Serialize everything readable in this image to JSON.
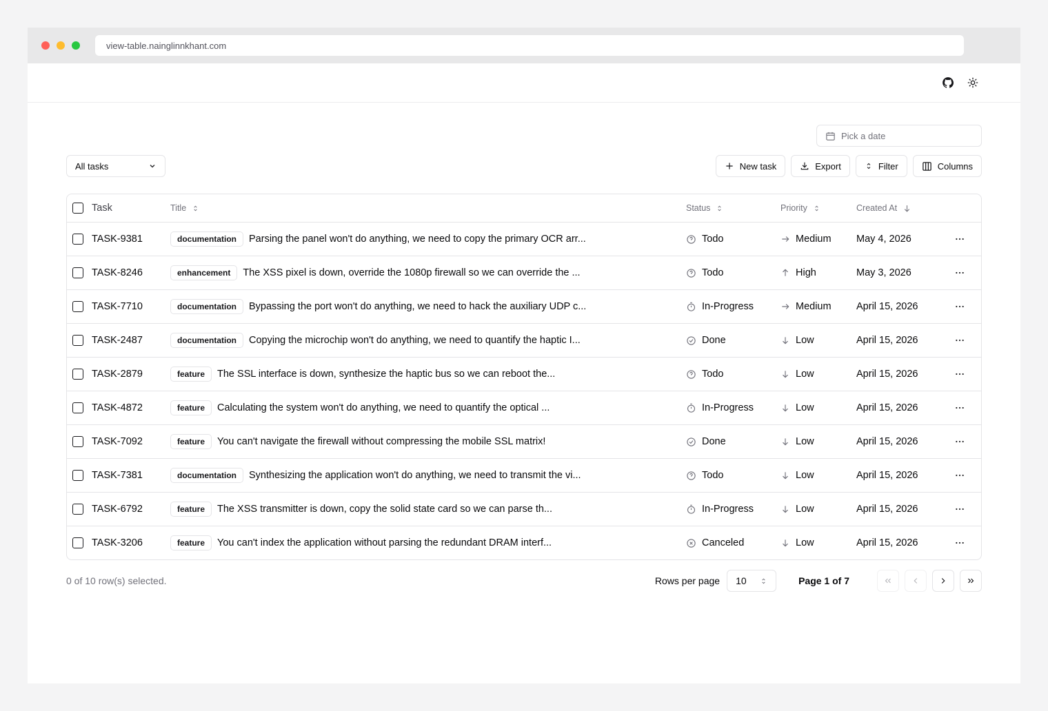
{
  "browser": {
    "url": "view-table.nainglinnkhant.com"
  },
  "header": {
    "github_icon": "github-icon",
    "theme_icon": "sun-icon"
  },
  "date_picker": {
    "placeholder": "Pick a date"
  },
  "toolbar": {
    "view_select": "All tasks",
    "new_task": "New task",
    "export": "Export",
    "filter": "Filter",
    "columns": "Columns"
  },
  "table": {
    "headers": {
      "task": "Task",
      "title": "Title",
      "status": "Status",
      "priority": "Priority",
      "created": "Created At"
    },
    "rows": [
      {
        "id": "TASK-9381",
        "label": "documentation",
        "title": "Parsing the panel won't do anything, we need to copy the primary OCR arr...",
        "status": "Todo",
        "priority": "Medium",
        "created": "May 4, 2026"
      },
      {
        "id": "TASK-8246",
        "label": "enhancement",
        "title": "The XSS pixel is down, override the 1080p firewall so we can override the ...",
        "status": "Todo",
        "priority": "High",
        "created": "May 3, 2026"
      },
      {
        "id": "TASK-7710",
        "label": "documentation",
        "title": "Bypassing the port won't do anything, we need to hack the auxiliary UDP c...",
        "status": "In-Progress",
        "priority": "Medium",
        "created": "April 15, 2026"
      },
      {
        "id": "TASK-2487",
        "label": "documentation",
        "title": "Copying the microchip won't do anything, we need to quantify the haptic I...",
        "status": "Done",
        "priority": "Low",
        "created": "April 15, 2026"
      },
      {
        "id": "TASK-2879",
        "label": "feature",
        "title": "The SSL interface is down, synthesize the haptic bus so we can reboot the...",
        "status": "Todo",
        "priority": "Low",
        "created": "April 15, 2026"
      },
      {
        "id": "TASK-4872",
        "label": "feature",
        "title": "Calculating the system won't do anything, we need to quantify the optical ...",
        "status": "In-Progress",
        "priority": "Low",
        "created": "April 15, 2026"
      },
      {
        "id": "TASK-7092",
        "label": "feature",
        "title": "You can't navigate the firewall without compressing the mobile SSL matrix!",
        "status": "Done",
        "priority": "Low",
        "created": "April 15, 2026"
      },
      {
        "id": "TASK-7381",
        "label": "documentation",
        "title": "Synthesizing the application won't do anything, we need to transmit the vi...",
        "status": "Todo",
        "priority": "Low",
        "created": "April 15, 2026"
      },
      {
        "id": "TASK-6792",
        "label": "feature",
        "title": "The XSS transmitter is down, copy the solid state card so we can parse th...",
        "status": "In-Progress",
        "priority": "Low",
        "created": "April 15, 2026"
      },
      {
        "id": "TASK-3206",
        "label": "feature",
        "title": "You can't index the application without parsing the redundant DRAM interf...",
        "status": "Canceled",
        "priority": "Low",
        "created": "April 15, 2026"
      }
    ]
  },
  "footer": {
    "selected": "0 of 10 row(s) selected.",
    "rows_per_page_label": "Rows per page",
    "rows_per_page_value": "10",
    "page_info": "Page 1 of 7"
  }
}
